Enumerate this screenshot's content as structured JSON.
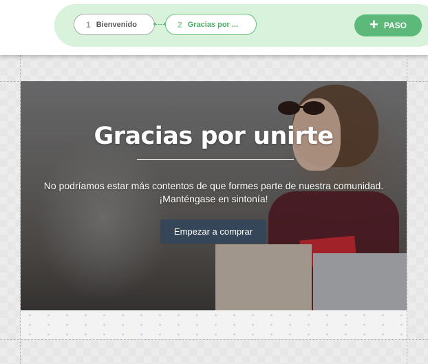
{
  "steps": [
    {
      "number": "1",
      "label": "Bienvenido"
    },
    {
      "number": "2",
      "label": "Gracias por ..."
    }
  ],
  "add_step_label": "PASO",
  "icons": {
    "add": "plus-icon"
  },
  "colors": {
    "accent_green": "#5cb97a",
    "stepper_bg": "#d9f2dc",
    "cta_bg": "#344657"
  },
  "hero": {
    "title": "Gracias por unirte",
    "line1": "No podríamos estar más contentos de que formes parte de nuestra comunidad.",
    "line2": "¡Manténgase en sintonía!",
    "cta_label": "Empezar a comprar"
  }
}
